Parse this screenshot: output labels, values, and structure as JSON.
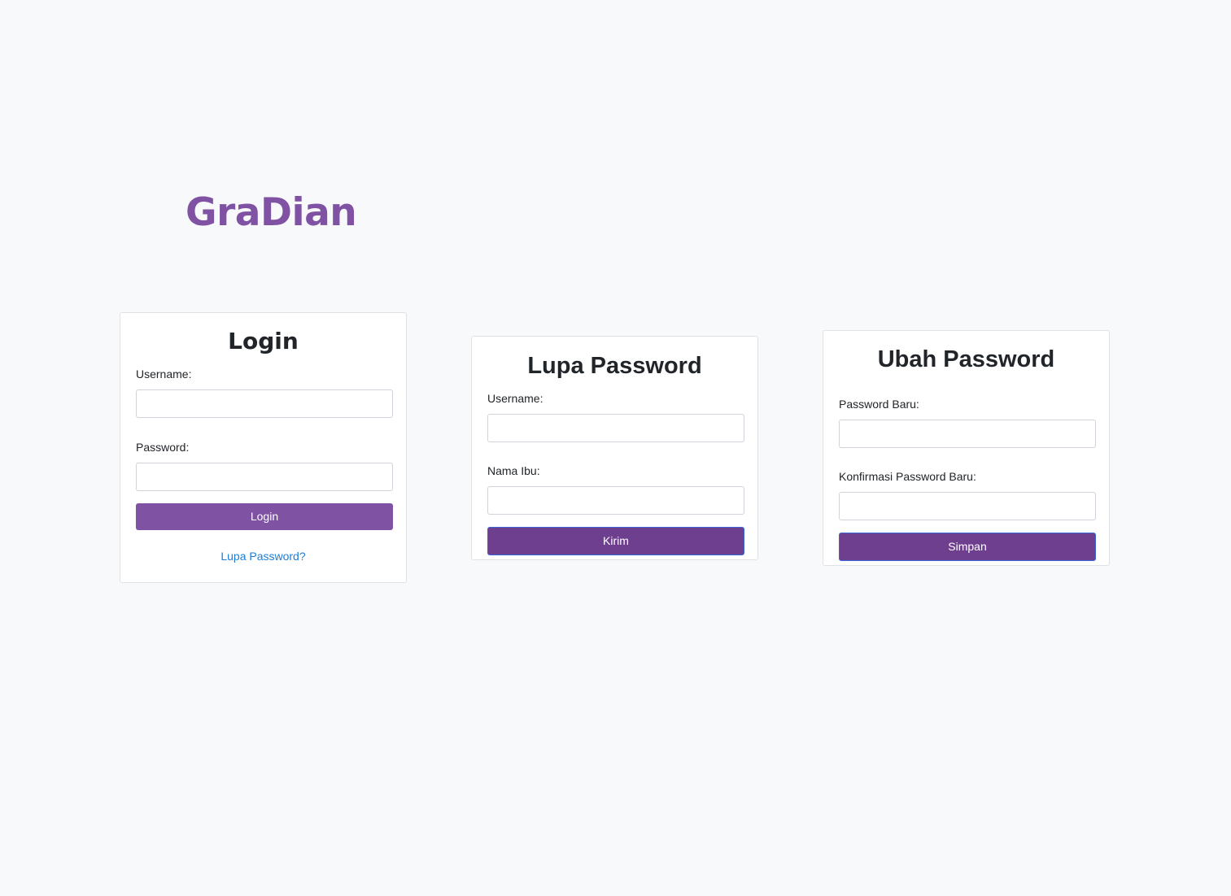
{
  "colors": {
    "brand": "#7f52a3",
    "background": "#f8f9fa",
    "button_primary": "#7f52a3",
    "button_dark": "#6f3f8f",
    "link": "#1b7ed6"
  },
  "brand": {
    "title": "GraDian"
  },
  "login_card": {
    "title": "Login",
    "username_label": "Username:",
    "username_value": "",
    "password_label": "Password:",
    "password_value": "",
    "submit_label": "Login",
    "forgot_link": "Lupa Password?"
  },
  "lupa_card": {
    "title": "Lupa Password",
    "username_label": "Username:",
    "username_value": "",
    "nama_ibu_label": "Nama Ibu:",
    "nama_ibu_value": "",
    "submit_label": "Kirim"
  },
  "ubah_card": {
    "title": "Ubah Password",
    "new_password_label": "Password Baru:",
    "new_password_value": "",
    "confirm_label": "Konfirmasi Password Baru:",
    "confirm_value": "",
    "submit_label": "Simpan"
  }
}
